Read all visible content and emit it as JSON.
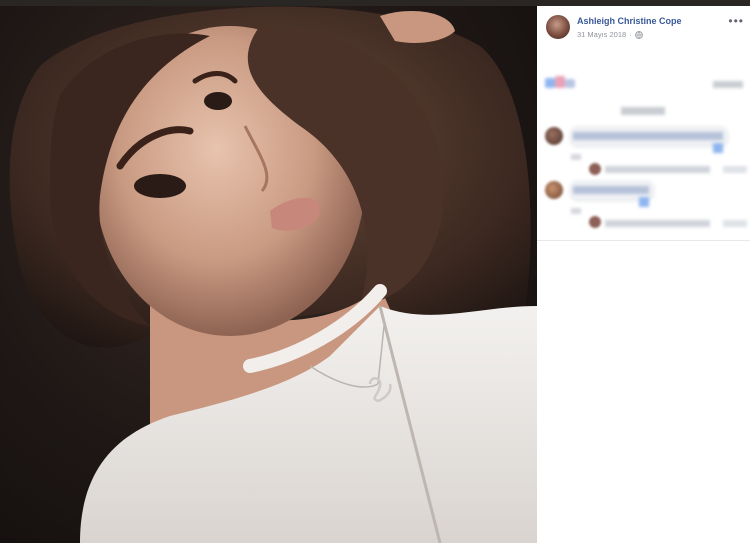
{
  "post": {
    "author": "Ashleigh Christine Cope",
    "date": "31 Mayıs 2018",
    "privacy_icon": "globe-icon",
    "more_icon": "more-options-icon"
  },
  "photo": {
    "description_icon": "selfie-photo"
  },
  "colors": {
    "author_link": "#385898",
    "meta": "#90949c",
    "panel_bg": "#ffffff"
  }
}
